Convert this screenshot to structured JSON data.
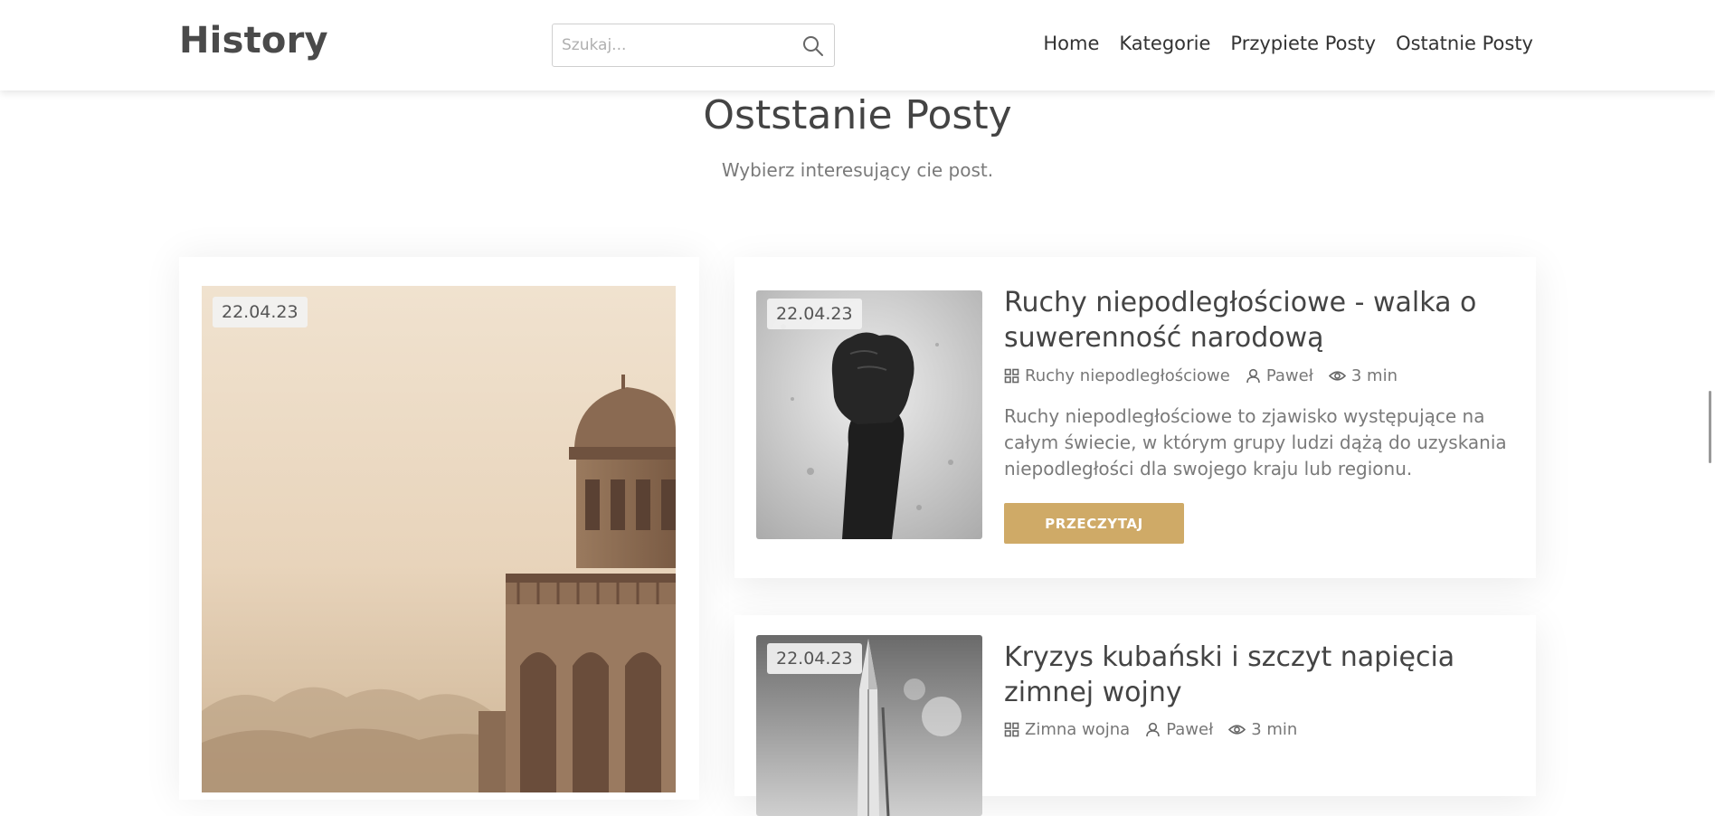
{
  "header": {
    "logo": "History",
    "search": {
      "placeholder": "Szukaj...",
      "value": ""
    },
    "nav": [
      "Home",
      "Kategorie",
      "Przypiete Posty",
      "Ostatnie Posty"
    ]
  },
  "section": {
    "title": "Oststanie Posty",
    "subtitle": "Wybierz interesujący cie post."
  },
  "featured": {
    "date": "22.04.23"
  },
  "posts": [
    {
      "date": "22.04.23",
      "title": "Ruchy niepodległościowe - walka o suwerenność narodową",
      "category": "Ruchy niepodległościowe",
      "author": "Paweł",
      "read_time": "3 min",
      "excerpt": "Ruchy niepodległościowe to zjawisko występujące na całym świecie, w którym grupy ludzi dążą do uzyskania niepodległości dla swojego kraju lub regionu.",
      "button": "PRZECZYTAJ"
    },
    {
      "date": "22.04.23",
      "title": "Kryzys kubański i szczyt napięcia zimnej wojny",
      "category": "Zimna wojna",
      "author": "Paweł",
      "read_time": "3 min"
    }
  ],
  "colors": {
    "accent": "#cfaa67",
    "text": "#444444",
    "muted": "#7a7a7a"
  },
  "icons": [
    "search-icon",
    "category-icon",
    "user-icon",
    "eye-icon"
  ]
}
